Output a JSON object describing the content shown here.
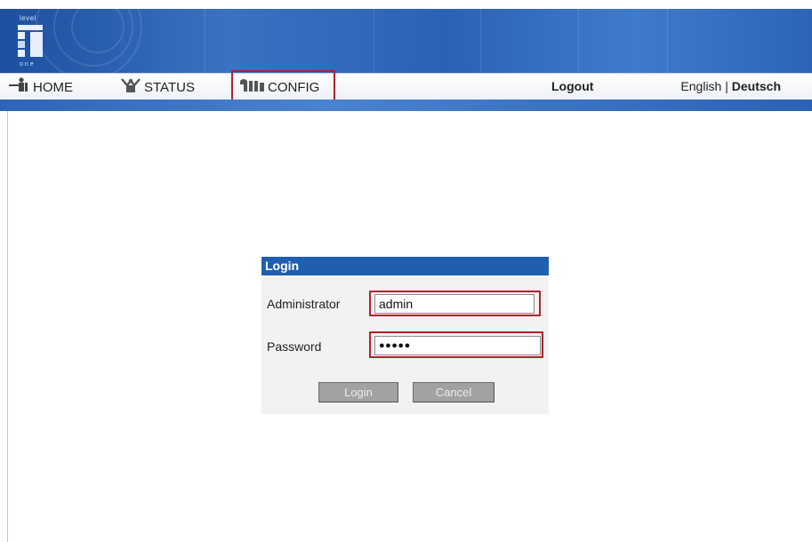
{
  "brand": {
    "logo_top": "level",
    "logo_bottom": "one"
  },
  "nav": {
    "home": {
      "label": "HOME",
      "icon": "home-icon"
    },
    "status": {
      "label": "STATUS",
      "icon": "status-icon"
    },
    "config": {
      "label": "CONFIG",
      "icon": "config-icon"
    },
    "logout": "Logout",
    "lang_english": "English",
    "lang_sep": "|",
    "lang_deutsch": "Deutsch"
  },
  "login": {
    "title": "Login",
    "admin_label": "Administrator",
    "admin_value": "admin",
    "password_label": "Password",
    "password_value": "●●●●●",
    "login_button": "Login",
    "cancel_button": "Cancel"
  },
  "colors": {
    "banner": "#2a62b6",
    "login_header": "#1f5fb0",
    "highlight": "#b2202a",
    "button": "#a2a2a2"
  }
}
